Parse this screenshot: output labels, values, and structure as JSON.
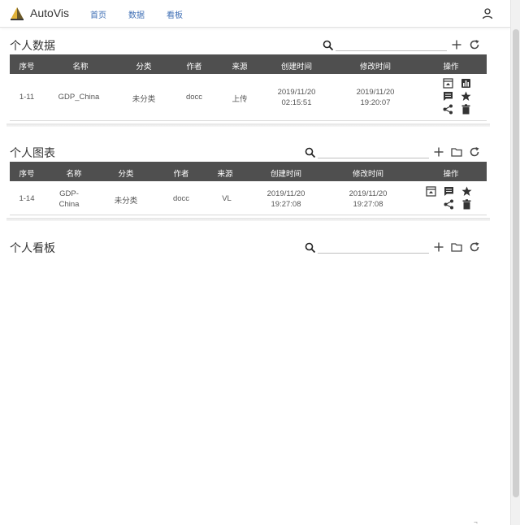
{
  "header": {
    "app_title": "AutoVis",
    "nav": [
      "首页",
      "数据",
      "看板"
    ],
    "accent_color": "#3f6fb5",
    "logo_icon": "pyramid-logo",
    "user_icon": "user-icon"
  },
  "data_section": {
    "title": "个人数据",
    "search_placeholder": "",
    "columns": [
      "序号",
      "名称",
      "分类",
      "作者",
      "来源",
      "创建时间",
      "修改时间",
      "操作"
    ],
    "rows": [
      {
        "id": "1-11",
        "name": "GDP_China",
        "category": "未分类",
        "author": "docc",
        "source": "上传",
        "created": [
          "2019/11/20",
          "02:15:51"
        ],
        "modified": [
          "2019/11/20",
          "19:20:07"
        ]
      }
    ]
  },
  "chart_section": {
    "title": "个人图表",
    "search_placeholder": "",
    "columns": [
      "序号",
      "名称",
      "分类",
      "作者",
      "来源",
      "创建时间",
      "修改时间",
      "操作"
    ],
    "rows": [
      {
        "id": "1-14",
        "name": [
          "GDP-",
          "China"
        ],
        "category": "未分类",
        "author": "docc",
        "source": "VL",
        "created": [
          "2019/11/20",
          "19:27:08"
        ],
        "modified": [
          "2019/11/20",
          "19:27:08"
        ]
      }
    ]
  },
  "dashboard_section": {
    "title": "个人看板",
    "search_placeholder": ""
  },
  "corner_mark": "¬"
}
